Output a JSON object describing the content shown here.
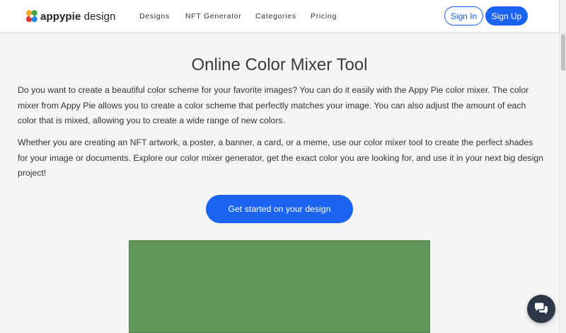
{
  "header": {
    "logo": {
      "brand": "appypie",
      "suffix": " design"
    },
    "nav": [
      {
        "label": "Designs"
      },
      {
        "label": "NFT Generator"
      },
      {
        "label": "Categories"
      },
      {
        "label": "Pricing"
      }
    ],
    "signin_label": "Sign In",
    "signup_label": "Sign Up"
  },
  "main": {
    "title": "Online Color Mixer Tool",
    "paragraph1": "Do you want to create a beautiful color scheme for your favorite images? You can do it easily with the Appy Pie color mixer. The color mixer from Appy Pie allows you to create a color scheme that perfectly matches your image. You can also adjust the amount of each color that is mixed, allowing you to create a wide range of new colors.",
    "paragraph2": "Whether you are creating an NFT artwork, a poster, a banner, a card, or a meme, use our color mixer tool to create the perfect shades for your image or documents. Explore our color mixer generator, get the exact color you are looking for, and use it in your next big design project!",
    "cta_label": "Get started on your design",
    "mixed_color": "#5f9757"
  },
  "colors": {
    "accent": "#1b64f2",
    "chat_button": "#2d3748"
  },
  "icons": {
    "logo": "appypie-logo-icon",
    "chat": "chat-bubbles-icon"
  }
}
